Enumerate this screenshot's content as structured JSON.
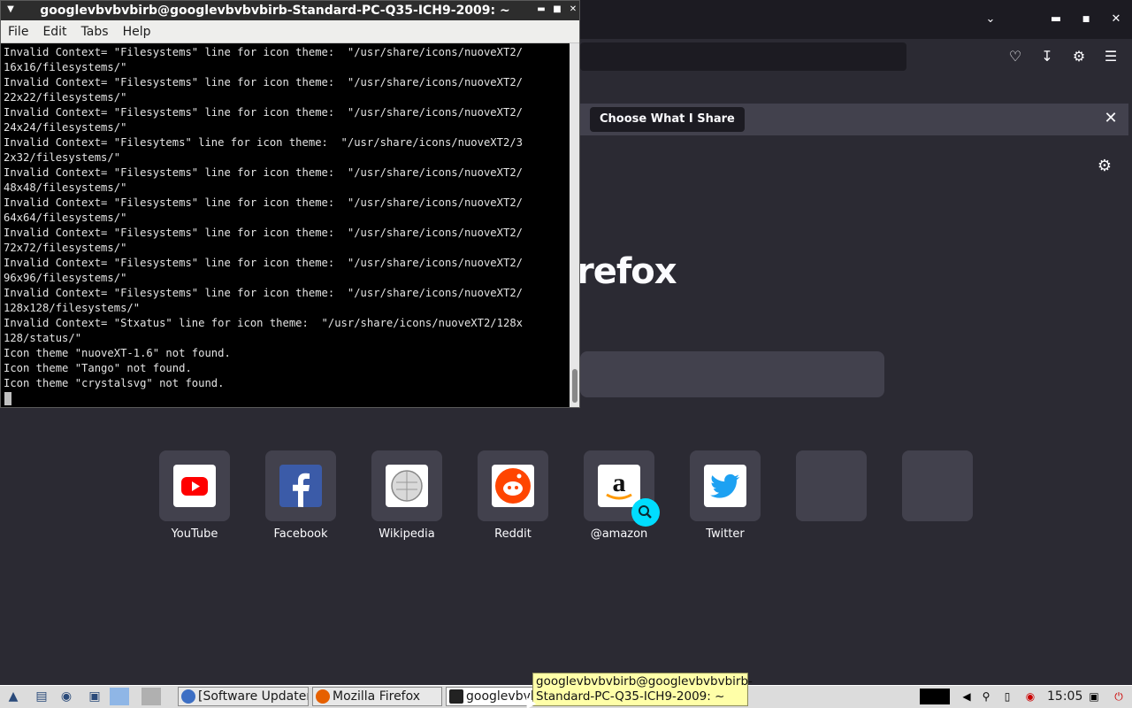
{
  "terminal": {
    "title": "googlevbvbvbirb@googlevbvbvbirb-Standard-PC-Q35-ICH9-2009: ~",
    "menu": [
      "File",
      "Edit",
      "Tabs",
      "Help"
    ],
    "lines": [
      "Invalid Context= \"Filesystems\" line for icon theme:  \"/usr/share/icons/nuoveXT2/",
      "16x16/filesystems/\"",
      "Invalid Context= \"Filesystems\" line for icon theme:  \"/usr/share/icons/nuoveXT2/",
      "22x22/filesystems/\"",
      "Invalid Context= \"Filesystems\" line for icon theme:  \"/usr/share/icons/nuoveXT2/",
      "24x24/filesystems/\"",
      "Invalid Context= \"Filesytems\" line for icon theme:  \"/usr/share/icons/nuoveXT2/3",
      "2x32/filesystems/\"",
      "Invalid Context= \"Filesystems\" line for icon theme:  \"/usr/share/icons/nuoveXT2/",
      "48x48/filesystems/\"",
      "Invalid Context= \"Filesystems\" line for icon theme:  \"/usr/share/icons/nuoveXT2/",
      "64x64/filesystems/\"",
      "Invalid Context= \"Filesystems\" line for icon theme:  \"/usr/share/icons/nuoveXT2/",
      "72x72/filesystems/\"",
      "Invalid Context= \"Filesystems\" line for icon theme:  \"/usr/share/icons/nuoveXT2/",
      "96x96/filesystems/\"",
      "Invalid Context= \"Filesystems\" line for icon theme:  \"/usr/share/icons/nuoveXT2/",
      "128x128/filesystems/\"",
      "Invalid Context= \"Stxatus\" line for icon theme:  \"/usr/share/icons/nuoveXT2/128x",
      "128/status/\"",
      "Icon theme \"nuoveXT-1.6\" not found.",
      "Icon theme \"Tango\" not found.",
      "Icon theme \"crystalsvg\" not found."
    ]
  },
  "firefox": {
    "notification_button": "Choose What I Share",
    "wordmark": "refox",
    "tiles": [
      {
        "label": "YouTube",
        "color": "#ff0000"
      },
      {
        "label": "Facebook",
        "color": "#1877f2"
      },
      {
        "label": "Wikipedia",
        "color": "#eeeeee"
      },
      {
        "label": "Reddit",
        "color": "#ff4500"
      },
      {
        "label": "@amazon",
        "color": "#ffffff"
      },
      {
        "label": "Twitter",
        "color": "#1da1f2"
      },
      {
        "label": "",
        "color": ""
      },
      {
        "label": "",
        "color": ""
      }
    ]
  },
  "taskbar": {
    "tasks": [
      "[Software Updater]",
      "Mozilla Firefox",
      "googlevbvb"
    ],
    "clock": "15:05"
  },
  "tooltip": {
    "line1": "googlevbvbvbirb@googlevbvbvbirb-",
    "line2": "Standard-PC-Q35-ICH9-2009: ~"
  },
  "colors": {
    "accent": "#00ddff",
    "firefox_bg": "#2b2a33"
  }
}
